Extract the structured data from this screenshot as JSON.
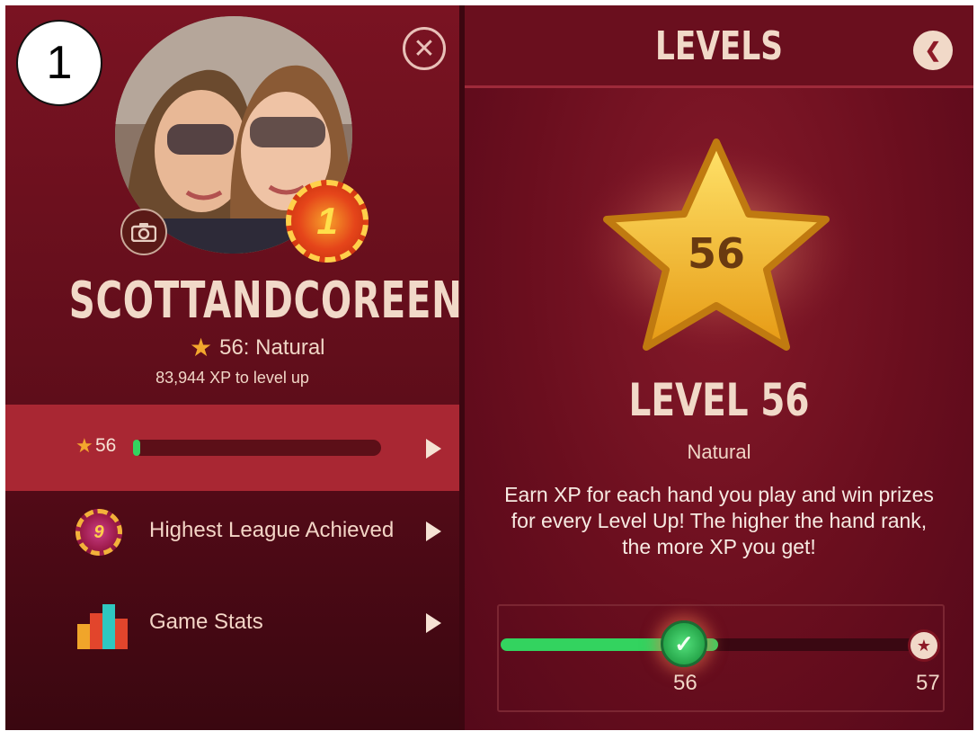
{
  "step_badge": "1",
  "profile": {
    "username": "SCOTTANDCOREEN",
    "rank_label": "56: Natural",
    "xp_to_level": "83,944 XP to level up",
    "chip_number": "1",
    "icons": {
      "camera": "camera-icon",
      "close": "close-icon",
      "star": "star-icon"
    }
  },
  "menu": {
    "level_row": {
      "level": "56",
      "progress_fraction": 0.03
    },
    "league_row": {
      "chip_number": "9",
      "label": "Highest League Achieved"
    },
    "stats_row": {
      "label": "Game Stats"
    }
  },
  "levels_panel": {
    "title": "LEVELS",
    "star_number": "56",
    "level_title": "LEVEL 56",
    "level_name": "Natural",
    "description": "Earn XP for each hand you play and win prizes for every Level Up! The higher the hand rank, the more XP you get!",
    "progress": {
      "current": "56",
      "next": "57",
      "fraction": 0.5
    }
  },
  "colors": {
    "accent_green": "#33d35f",
    "highlight_row": "#a92733",
    "star_gold": "#f3a72d",
    "text_cream": "#f1d9c8"
  }
}
